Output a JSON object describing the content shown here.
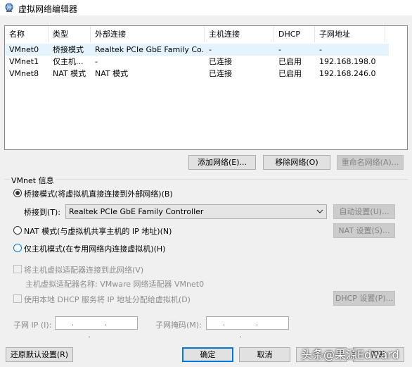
{
  "window": {
    "title": "虚拟网络编辑器"
  },
  "table": {
    "columns": [
      "名称",
      "类型",
      "外部连接",
      "主机连接",
      "DHCP",
      "子网地址"
    ],
    "rows": [
      {
        "name": "VMnet0",
        "type": "桥接模式",
        "external": "Realtek PCIe GbE Family Co...",
        "host": "-",
        "dhcp": "-",
        "subnet": "-",
        "selected": true
      },
      {
        "name": "VMnet1",
        "type": "仅主机...",
        "external": "-",
        "host": "已连接",
        "dhcp": "已启用",
        "subnet": "192.168.198.0",
        "selected": false
      },
      {
        "name": "VMnet8",
        "type": "NAT 模式",
        "external": "NAT 模式",
        "host": "已连接",
        "dhcp": "已启用",
        "subnet": "192.168.246.0",
        "selected": false
      }
    ]
  },
  "buttons": {
    "add_network": "添加网络(E)...",
    "remove_network": "移除网络(O)",
    "rename_network": "重命名网络(A)...",
    "auto_settings": "自动设置(U)...",
    "nat_settings": "NAT 设置(S)...",
    "dhcp_settings": "DHCP 设置(P)...",
    "restore_defaults": "还原默认设置(R)",
    "ok": "确定",
    "cancel": "取消",
    "help": "帮助"
  },
  "vmnet_info": {
    "group_label": "VMnet 信息",
    "bridged_label": "桥接模式(将虚拟机直接连接到外部网络)(B)",
    "bridge_to_label": "桥接到(T):",
    "bridge_to_value": "Realtek PCIe GbE Family Controller",
    "nat_label": "NAT 模式(与虚拟机共享主机的 IP 地址)(N)",
    "host_only_label": "仅主机模式(在专用网络内连接虚拟机)(H)",
    "connect_adapter_label": "将主机虚拟适配器连接到此网络(V)",
    "adapter_name_label": "主机虚拟适配器名称: VMware 网络适配器 VMnet0",
    "use_dhcp_label": "使用本地 DHCP 服务将 IP 地址分配给虚拟机(D)",
    "subnet_ip_label": "子网 IP (I):",
    "subnet_mask_label": "子网掩码(M):",
    "ip_placeholder": ". . ."
  },
  "watermark": "头条@果源Edward",
  "colors": {
    "selected_row": "#e5f3ff",
    "accent": "#0078d7"
  }
}
